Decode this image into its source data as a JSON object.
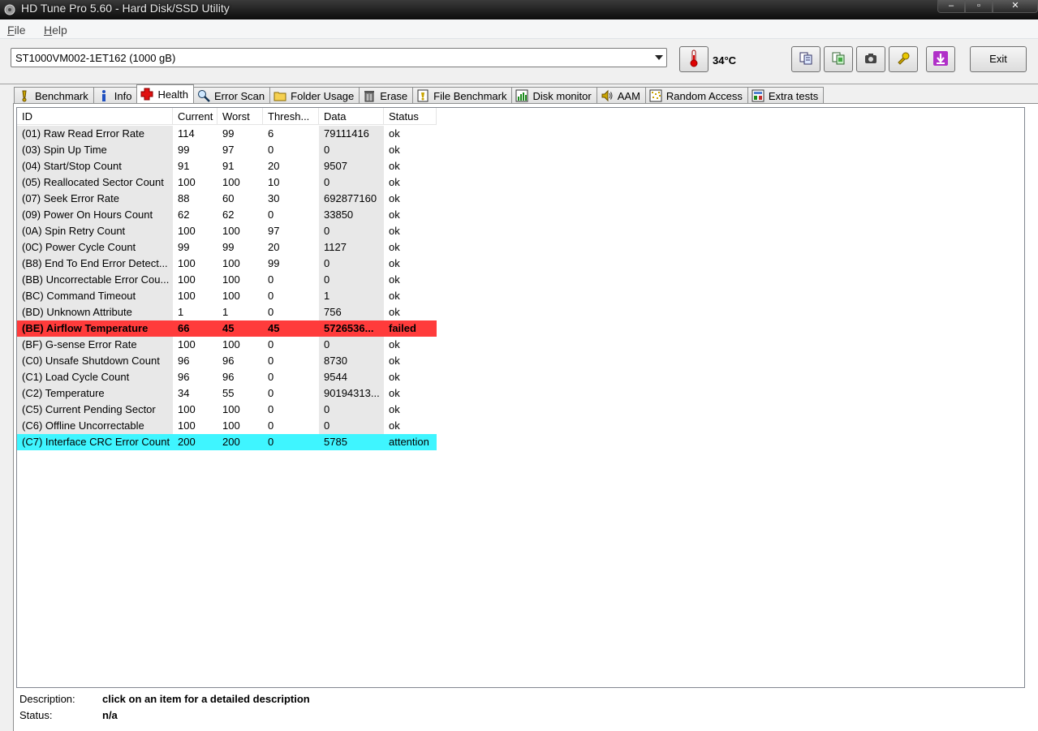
{
  "window": {
    "title": "HD Tune Pro 5.60 - Hard Disk/SSD Utility"
  },
  "menu": [
    {
      "label": "File",
      "accel": "F",
      "rest": "ile"
    },
    {
      "label": "Help",
      "accel": "H",
      "rest": "elp"
    }
  ],
  "toolbar": {
    "drive": "ST1000VM002-1ET162 (1000 gB)",
    "temperature": "34°C",
    "exit_label": "Exit"
  },
  "tabs": [
    {
      "label": "Benchmark",
      "icon": "benchmark-icon"
    },
    {
      "label": "Info",
      "icon": "info-icon"
    },
    {
      "label": "Health",
      "icon": "health-cross-icon",
      "active": true
    },
    {
      "label": "Error Scan",
      "icon": "magnifier-icon"
    },
    {
      "label": "Folder Usage",
      "icon": "folder-icon"
    },
    {
      "label": "Erase",
      "icon": "trash-icon"
    },
    {
      "label": "File Benchmark",
      "icon": "file-benchmark-icon"
    },
    {
      "label": "Disk monitor",
      "icon": "disk-monitor-icon"
    },
    {
      "label": "AAM",
      "icon": "speaker-icon"
    },
    {
      "label": "Random Access",
      "icon": "random-access-icon"
    },
    {
      "label": "Extra tests",
      "icon": "extra-tests-icon"
    }
  ],
  "table": {
    "columns": [
      "ID",
      "Current",
      "Worst",
      "Thresh...",
      "Data",
      "Status"
    ],
    "rows": [
      [
        "(01) Raw Read Error Rate",
        "114",
        "99",
        "6",
        "79111416",
        "ok"
      ],
      [
        "(03) Spin Up Time",
        "99",
        "97",
        "0",
        "0",
        "ok"
      ],
      [
        "(04) Start/Stop Count",
        "91",
        "91",
        "20",
        "9507",
        "ok"
      ],
      [
        "(05) Reallocated Sector Count",
        "100",
        "100",
        "10",
        "0",
        "ok"
      ],
      [
        "(07) Seek Error Rate",
        "88",
        "60",
        "30",
        "692877160",
        "ok"
      ],
      [
        "(09) Power On Hours Count",
        "62",
        "62",
        "0",
        "33850",
        "ok"
      ],
      [
        "(0A) Spin Retry Count",
        "100",
        "100",
        "97",
        "0",
        "ok"
      ],
      [
        "(0C) Power Cycle Count",
        "99",
        "99",
        "20",
        "1127",
        "ok"
      ],
      [
        "(B8) End To End Error Detect...",
        "100",
        "100",
        "99",
        "0",
        "ok"
      ],
      [
        "(BB) Uncorrectable Error Cou...",
        "100",
        "100",
        "0",
        "0",
        "ok"
      ],
      [
        "(BC) Command Timeout",
        "100",
        "100",
        "0",
        "1",
        "ok"
      ],
      [
        "(BD) Unknown Attribute",
        "1",
        "1",
        "0",
        "756",
        "ok"
      ],
      [
        "(BE) Airflow Temperature",
        "66",
        "45",
        "45",
        "5726536...",
        "failed"
      ],
      [
        "(BF) G-sense Error Rate",
        "100",
        "100",
        "0",
        "0",
        "ok"
      ],
      [
        "(C0) Unsafe Shutdown Count",
        "96",
        "96",
        "0",
        "8730",
        "ok"
      ],
      [
        "(C1) Load Cycle Count",
        "96",
        "96",
        "0",
        "9544",
        "ok"
      ],
      [
        "(C2) Temperature",
        "34",
        "55",
        "0",
        "90194313...",
        "ok"
      ],
      [
        "(C5) Current Pending Sector",
        "100",
        "100",
        "0",
        "0",
        "ok"
      ],
      [
        "(C6) Offline Uncorrectable",
        "100",
        "100",
        "0",
        "0",
        "ok"
      ],
      [
        "(C7) Interface CRC Error Count",
        "200",
        "200",
        "0",
        "5785",
        "attention"
      ]
    ]
  },
  "description": {
    "label": "Description:",
    "value": "click on an item for a detailed description",
    "status_label": "Status:",
    "status_value": "n/a"
  },
  "colors": {
    "failed": "#ff3b3b",
    "attention": "#3ff5ff"
  }
}
